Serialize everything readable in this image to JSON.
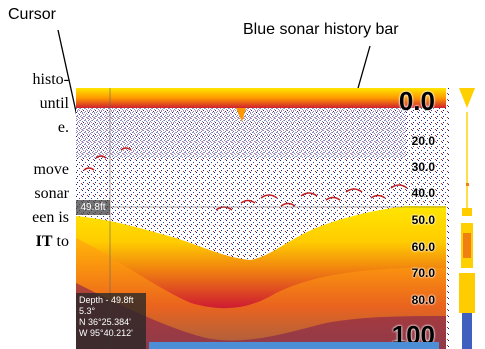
{
  "callouts": {
    "cursor": "Cursor",
    "history_bar": "Blue sonar history bar"
  },
  "side_text": {
    "line1": "histo-",
    "line2": "until",
    "line3": "e.",
    "line4": "move",
    "line5": "sonar",
    "line6": "een is",
    "line7_bold": "IT",
    "line7_rest": " to"
  },
  "depth_scale": [
    "0.0",
    "20.0",
    "30.0",
    "40.0",
    "50.0",
    "60.0",
    "70.0",
    "80.0",
    "100"
  ],
  "cursor_depth": "49.8ft",
  "readout": {
    "depth": "Depth - 49.8ft",
    "value": "5.3°",
    "lat": "N  36°25.384'",
    "lon": "W  95°40.212'"
  },
  "colors": {
    "surface": "#ff9800",
    "bottom_yellow": "#ffe600",
    "bottom_red": "#e03020",
    "noise": "#1a1a80",
    "history_bar": "#4d8fd6"
  }
}
